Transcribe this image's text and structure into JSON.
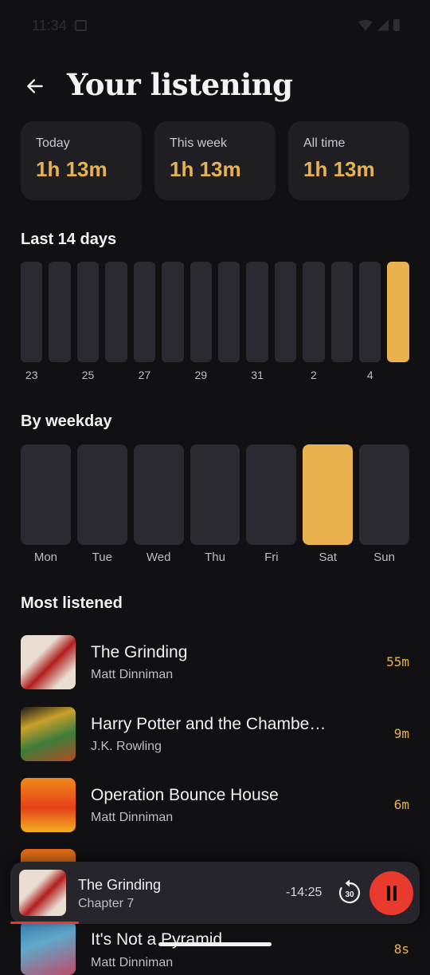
{
  "status_bar": {
    "time": "11:34"
  },
  "header": {
    "title": "Your listening"
  },
  "stats": [
    {
      "label": "Today",
      "value": "1h 13m"
    },
    {
      "label": "This week",
      "value": "1h 13m"
    },
    {
      "label": "All time",
      "value": "1h 13m"
    }
  ],
  "last14": {
    "heading": "Last 14 days",
    "tick_labels": [
      "23",
      "",
      "25",
      "",
      "27",
      "",
      "29",
      "",
      "31",
      "",
      "2",
      "",
      "4",
      ""
    ],
    "highlighted_index": 13
  },
  "weekday": {
    "heading": "By weekday",
    "days": [
      "Mon",
      "Tue",
      "Wed",
      "Thu",
      "Fri",
      "Sat",
      "Sun"
    ],
    "highlighted_index": 5
  },
  "most_listened": {
    "heading": "Most listened",
    "items": [
      {
        "title": "The Grinding",
        "author": "Matt Dinniman",
        "time": "55m"
      },
      {
        "title": "Harry Potter and the Chamber of Secrets",
        "author": "J.K. Rowling",
        "time": "9m"
      },
      {
        "title": "Operation Bounce House",
        "author": "Matt Dinniman",
        "time": "6m"
      },
      {
        "title": "",
        "author": "",
        "time": ""
      },
      {
        "title": "It's Not a Pyramid",
        "author": "Matt Dinniman",
        "time": "8s"
      }
    ]
  },
  "player": {
    "title": "The Grinding",
    "chapter": "Chapter 7",
    "remaining": "-14:25",
    "skip_seconds": "30"
  },
  "colors": {
    "accent": "#e9b24f",
    "bar_inactive": "#2a2a30",
    "card_bg": "#1e1e23",
    "background": "#111114",
    "pause_button": "#ea3a2e"
  }
}
